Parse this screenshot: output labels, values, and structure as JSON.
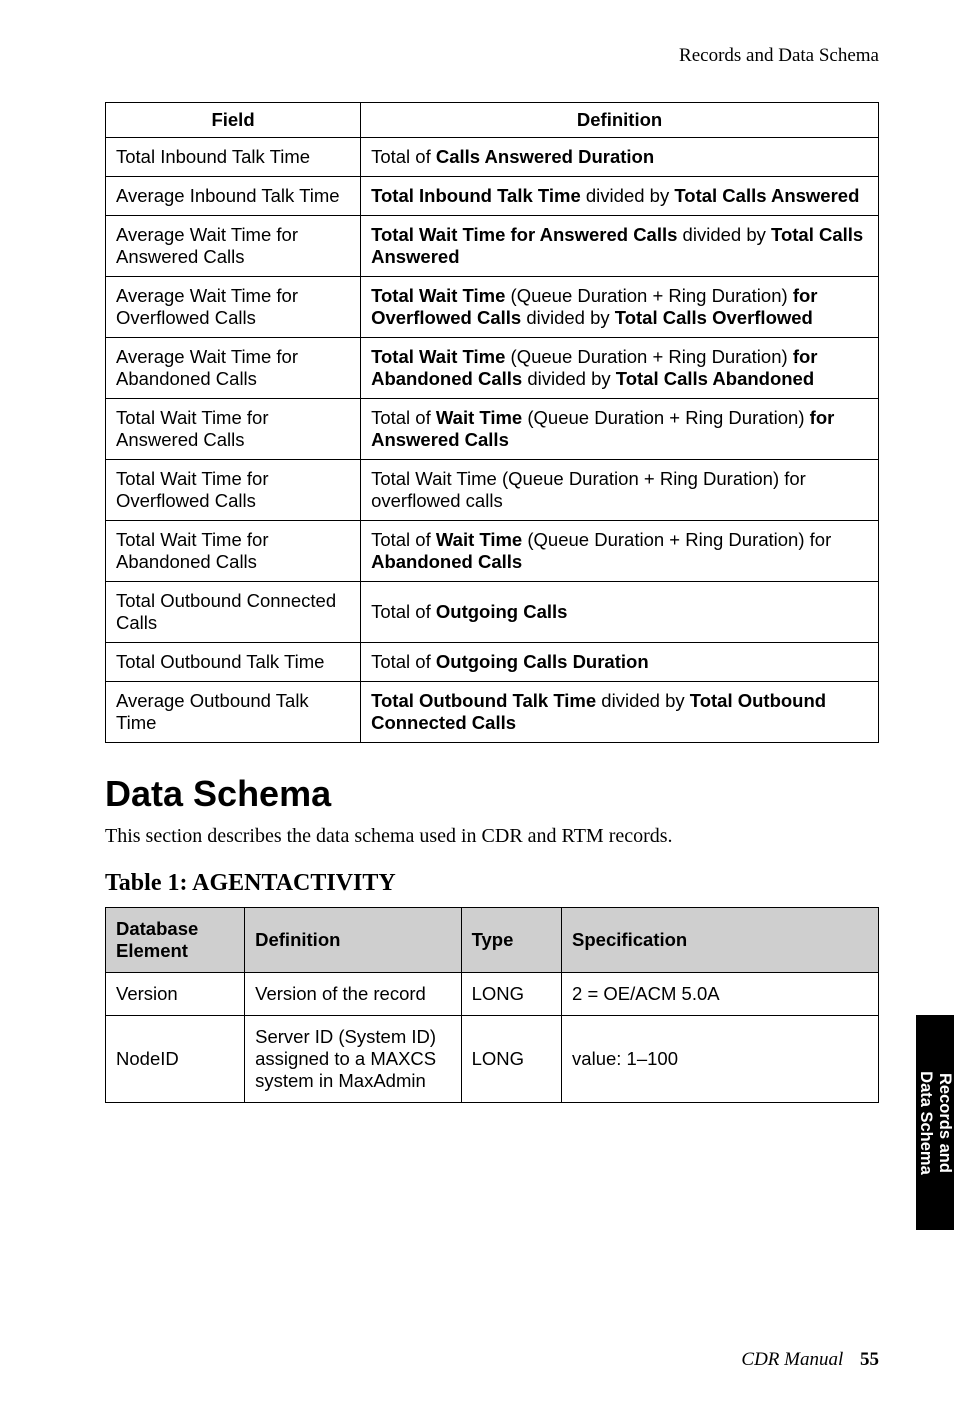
{
  "running_header": "Records and Data Schema",
  "defs_table": {
    "headers": {
      "field": "Field",
      "definition": "Definition"
    },
    "rows": [
      {
        "field": "Total Inbound Talk Time",
        "def_parts": [
          [
            "Total of ",
            false
          ],
          [
            "Calls Answered Duration",
            true
          ]
        ]
      },
      {
        "field": "Average Inbound Talk Time",
        "def_parts": [
          [
            "Total Inbound Talk Time",
            true
          ],
          [
            " divided by ",
            false
          ],
          [
            "Total Calls Answered",
            true
          ]
        ]
      },
      {
        "field": "Average Wait Time for Answered Calls",
        "def_parts": [
          [
            "Total Wait Time for Answered Calls",
            true
          ],
          [
            " divided by ",
            false
          ],
          [
            "Total Calls Answered",
            true
          ]
        ]
      },
      {
        "field": "Average Wait Time for Overflowed Calls",
        "def_parts": [
          [
            "Total Wait Time",
            true
          ],
          [
            " (Queue Duration + Ring Duration) ",
            false
          ],
          [
            "for Overflowed Calls",
            true
          ],
          [
            " divided by ",
            false
          ],
          [
            "Total Calls Overflowed",
            true
          ]
        ]
      },
      {
        "field": "Average Wait Time for Abandoned Calls",
        "def_parts": [
          [
            "Total Wait Time",
            true
          ],
          [
            " (Queue Duration + Ring Duration) ",
            false
          ],
          [
            "for Abandoned Calls",
            true
          ],
          [
            " divided by ",
            false
          ],
          [
            "Total Calls Abandoned",
            true
          ]
        ]
      },
      {
        "field": "Total Wait Time for Answered Calls",
        "def_parts": [
          [
            "Total of ",
            false
          ],
          [
            "Wait Time",
            true
          ],
          [
            " (Queue Duration + Ring Duration) ",
            false
          ],
          [
            "for Answered Calls",
            true
          ]
        ]
      },
      {
        "field": "Total Wait Time for Overflowed Calls",
        "def_parts": [
          [
            "Total Wait Time (Queue Duration + Ring Duration) for overflowed calls",
            false
          ]
        ]
      },
      {
        "field": "Total Wait Time for Abandoned Calls",
        "def_parts": [
          [
            "Total of ",
            false
          ],
          [
            "Wait Time",
            true
          ],
          [
            " (Queue Duration + Ring Duration) for ",
            false
          ],
          [
            "Abandoned Calls",
            true
          ]
        ]
      },
      {
        "field": "Total Outbound Connected Calls",
        "def_parts": [
          [
            "Total of ",
            false
          ],
          [
            "Outgoing Calls",
            true
          ]
        ]
      },
      {
        "field": "Total Outbound Talk Time",
        "def_parts": [
          [
            "Total of ",
            false
          ],
          [
            "Outgoing Calls Duration",
            true
          ]
        ]
      },
      {
        "field": "Average Outbound Talk Time",
        "def_parts": [
          [
            "Total Outbound Talk Time",
            true
          ],
          [
            " divided by ",
            false
          ],
          [
            "Total Outbound Connected Calls",
            true
          ]
        ]
      }
    ]
  },
  "section": {
    "title": "Data Schema",
    "body": "This section describes the data schema used in CDR and RTM records.",
    "table_caption": "Table 1: AGENTACTIVITY"
  },
  "schema_table": {
    "headers": {
      "db": "Database Element",
      "def": "Definition",
      "type": "Type",
      "spec": "Specification"
    },
    "rows": [
      {
        "db": "Version",
        "def": "Version of the record",
        "type": "LONG",
        "spec": "2 = OE/ACM 5.0A"
      },
      {
        "db": "NodeID",
        "def": "Server ID (System ID) assigned to a MAXCS system in MaxAdmin",
        "type": "LONG",
        "spec": "value: 1–100"
      }
    ]
  },
  "side_tab": {
    "line1": "Records and",
    "line2": "Data Schema"
  },
  "footer": {
    "label": "CDR Manual",
    "page": "55"
  }
}
